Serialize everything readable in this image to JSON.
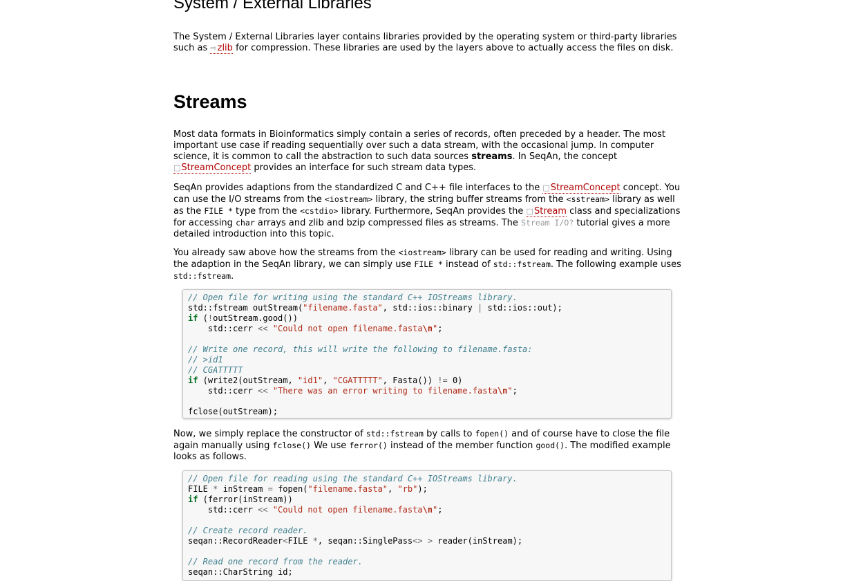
{
  "sections": {
    "system_heading": "System / External Libraries",
    "system_para": {
      "t1": "The System / External Libraries layer contains libraries provided by the operating system or third-party libraries such as ",
      "link_zlib": "zlib",
      "t2": " for compression. These libraries are used by the layers above to actually access the files on disk."
    },
    "streams_heading": "Streams",
    "para1": {
      "t1": "Most data formats in Bioinformatics simply contain a series of records, often preceded by a header. The most important use case if reading sequentially over such a data stream, with the occasional jump. In computer science, it is common to call the abstraction to such data sources ",
      "bold": "streams",
      "t2": ". In SeqAn, the concept ",
      "link": "StreamConcept",
      "t3": " provides an interface for such stream data types."
    },
    "para2": {
      "t1": "SeqAn provides adaptions from the standardized C and C++ file interfaces to the ",
      "link1": "StreamConcept",
      "t2": " concept. You can use the I/O streams from the ",
      "c1": "<iostream>",
      "t3": " library, the string buffer streams from the ",
      "c2": "<sstream>",
      "t4": " library as well as the ",
      "c3": "FILE *",
      "t5": " type from the ",
      "c4": "<cstdio>",
      "t6": " library. Furthermore, SeqAn provides the ",
      "link2": "Stream",
      "t7": " class and specializations for accessing ",
      "c5": "char",
      "t8": " arrays and zlib and bzip compressed files as streams. The ",
      "link3": "Stream I/O?",
      "t9": " tutorial gives a more detailed introduction into this topic."
    },
    "para3": {
      "t1": "You already saw above how the streams from the ",
      "c1": "<iostream>",
      "t2": " library can be used for reading and writing. Using the adaption in the SeqAn library, we can simply use ",
      "c2": "FILE *",
      "t3": " instead of ",
      "c3": "std::fstream",
      "t4": ". The following example uses ",
      "c4": "std::fstream",
      "t5": "."
    },
    "para4": {
      "t1": "Now, we simply replace the constructor of ",
      "c1": "std::fstream",
      "t2": " by calls to ",
      "c2": "fopen()",
      "t3": " and of course have to close the file again manually using ",
      "c3": "fclose()",
      "t4": " We use ",
      "c4": "ferror()",
      "t5": " instead of the member function ",
      "c5": "good()",
      "t6": ". The modified example looks as follows."
    }
  },
  "code1": {
    "l1_cm": "// Open file for writing using the standard C++ IOStreams library.",
    "l2_a": "std::fstream outStream(",
    "l2_s": "\"filename.fasta\"",
    "l2_b": ", std::ios::binary ",
    "l2_op": "|",
    "l2_c": " std::ios::out);",
    "l3_kw": "if",
    "l3_a": " (",
    "l3_op": "!",
    "l3_b": "outStream.good())",
    "l4_a": "    std::cerr ",
    "l4_op": "<<",
    "l4_s": " \"Could not open filename.fasta",
    "l4_es": "\\n",
    "l4_s2": "\"",
    "l4_b": ";",
    "l6_cm": "// Write one record, this will write the following to filename.fasta:",
    "l7_cm": "// >id1",
    "l8_cm": "// CGATTTTT",
    "l9_kw": "if",
    "l9_a": " (write2(outStream, ",
    "l9_s1": "\"id1\"",
    "l9_b": ", ",
    "l9_s2": "\"CGATTTTT\"",
    "l9_c": ", Fasta()) ",
    "l9_op": "!=",
    "l9_d": " 0)",
    "l10_a": "    std::cerr ",
    "l10_op": "<<",
    "l10_s": " \"There was an error writing to filename.fasta",
    "l10_es": "\\n",
    "l10_s2": "\"",
    "l10_b": ";",
    "l12": "fclose(outStream);"
  },
  "code2": {
    "l1_cm": "// Open file for reading using the standard C++ IOStreams library.",
    "l2_a": "FILE ",
    "l2_op": "*",
    "l2_b": " inStream ",
    "l2_op2": "=",
    "l2_c": " fopen(",
    "l2_s1": "\"filename.fasta\"",
    "l2_d": ", ",
    "l2_s2": "\"rb\"",
    "l2_e": ");",
    "l3_kw": "if",
    "l3_a": " (ferror(inStream))",
    "l4_a": "    std::cerr ",
    "l4_op": "<<",
    "l4_s": " \"Could not open filename.fasta",
    "l4_es": "\\n",
    "l4_s2": "\"",
    "l4_b": ";",
    "l6_cm": "// Create record reader.",
    "l7_a": "seqan::RecordReader",
    "l7_op": "<",
    "l7_b": "FILE ",
    "l7_op2": "*",
    "l7_c": ", seqan::SinglePass",
    "l7_op3": "<>",
    "l7_d": " ",
    "l7_op4": ">",
    "l7_e": " reader(inStream);",
    "l9_cm": "// Read one record from the reader.",
    "l10": "seqan::CharString id;"
  },
  "icons": {
    "link_arrow": "⇨",
    "book": "📖"
  }
}
